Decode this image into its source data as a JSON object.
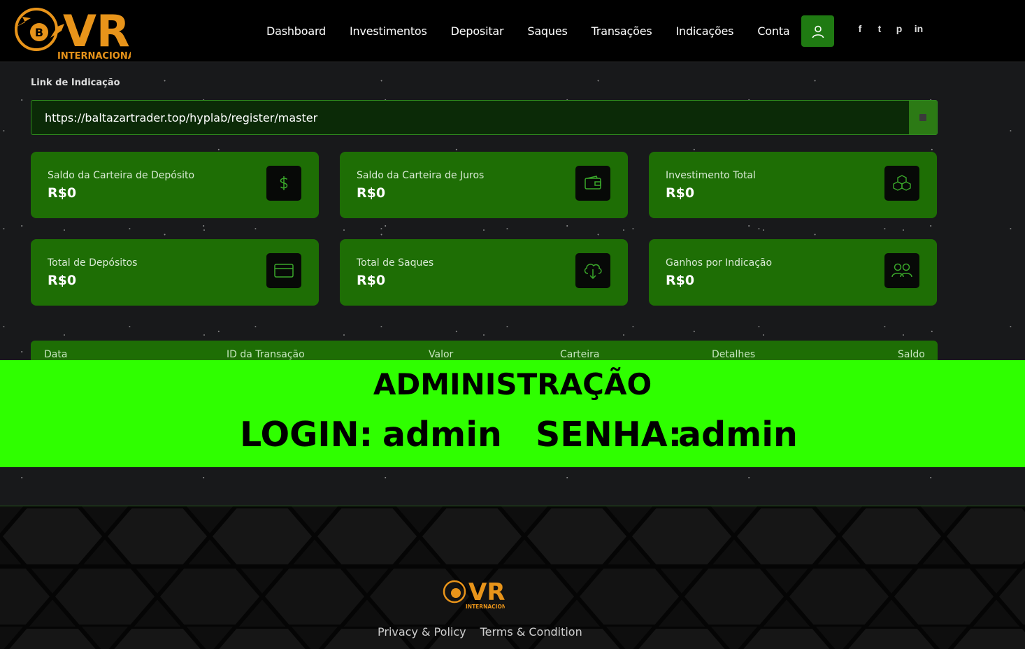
{
  "brand": {
    "logo_text": "VR",
    "logo_subtext": "INTERNACIONAL",
    "accent_color": "#e8941a"
  },
  "nav": {
    "items": [
      "Dashboard",
      "Investimentos",
      "Depositar",
      "Saques",
      "Transações",
      "Indicações",
      "Conta"
    ]
  },
  "header": {
    "user_icon": "user-icon",
    "socials": [
      "f",
      "t",
      "p",
      "in"
    ]
  },
  "referral": {
    "label": "Link de Indicação",
    "url": "https://baltazartrader.top/hyplab/register/master"
  },
  "cards": [
    {
      "title": "Saldo da Carteira de Depósito",
      "value": "R$0",
      "icon": "dollar-icon"
    },
    {
      "title": "Saldo da Carteira de Juros",
      "value": "R$0",
      "icon": "wallet-icon"
    },
    {
      "title": "Investimento Total",
      "value": "R$0",
      "icon": "boxes-icon"
    },
    {
      "title": "Total de Depósitos",
      "value": "R$0",
      "icon": "credit-card-icon"
    },
    {
      "title": "Total de Saques",
      "value": "R$0",
      "icon": "cloud-download-icon"
    },
    {
      "title": "Ganhos por Indicação",
      "value": "R$0",
      "icon": "users-icon"
    }
  ],
  "table": {
    "headers": [
      "Data",
      "ID da Transação",
      "Valor",
      "Carteira",
      "Detalhes",
      "Saldo"
    ]
  },
  "banner": {
    "title": "ADMINISTRAÇÃO",
    "login_label": "LOGIN:",
    "login_value": "admin",
    "password_label": "SENHA:",
    "password_value": "admin"
  },
  "footer": {
    "links": [
      "Privacy & Policy",
      "Terms & Condition"
    ]
  },
  "colors": {
    "card_green": "#1e6e05",
    "banner_green": "#2fff00",
    "button_green": "#1f7a12"
  }
}
